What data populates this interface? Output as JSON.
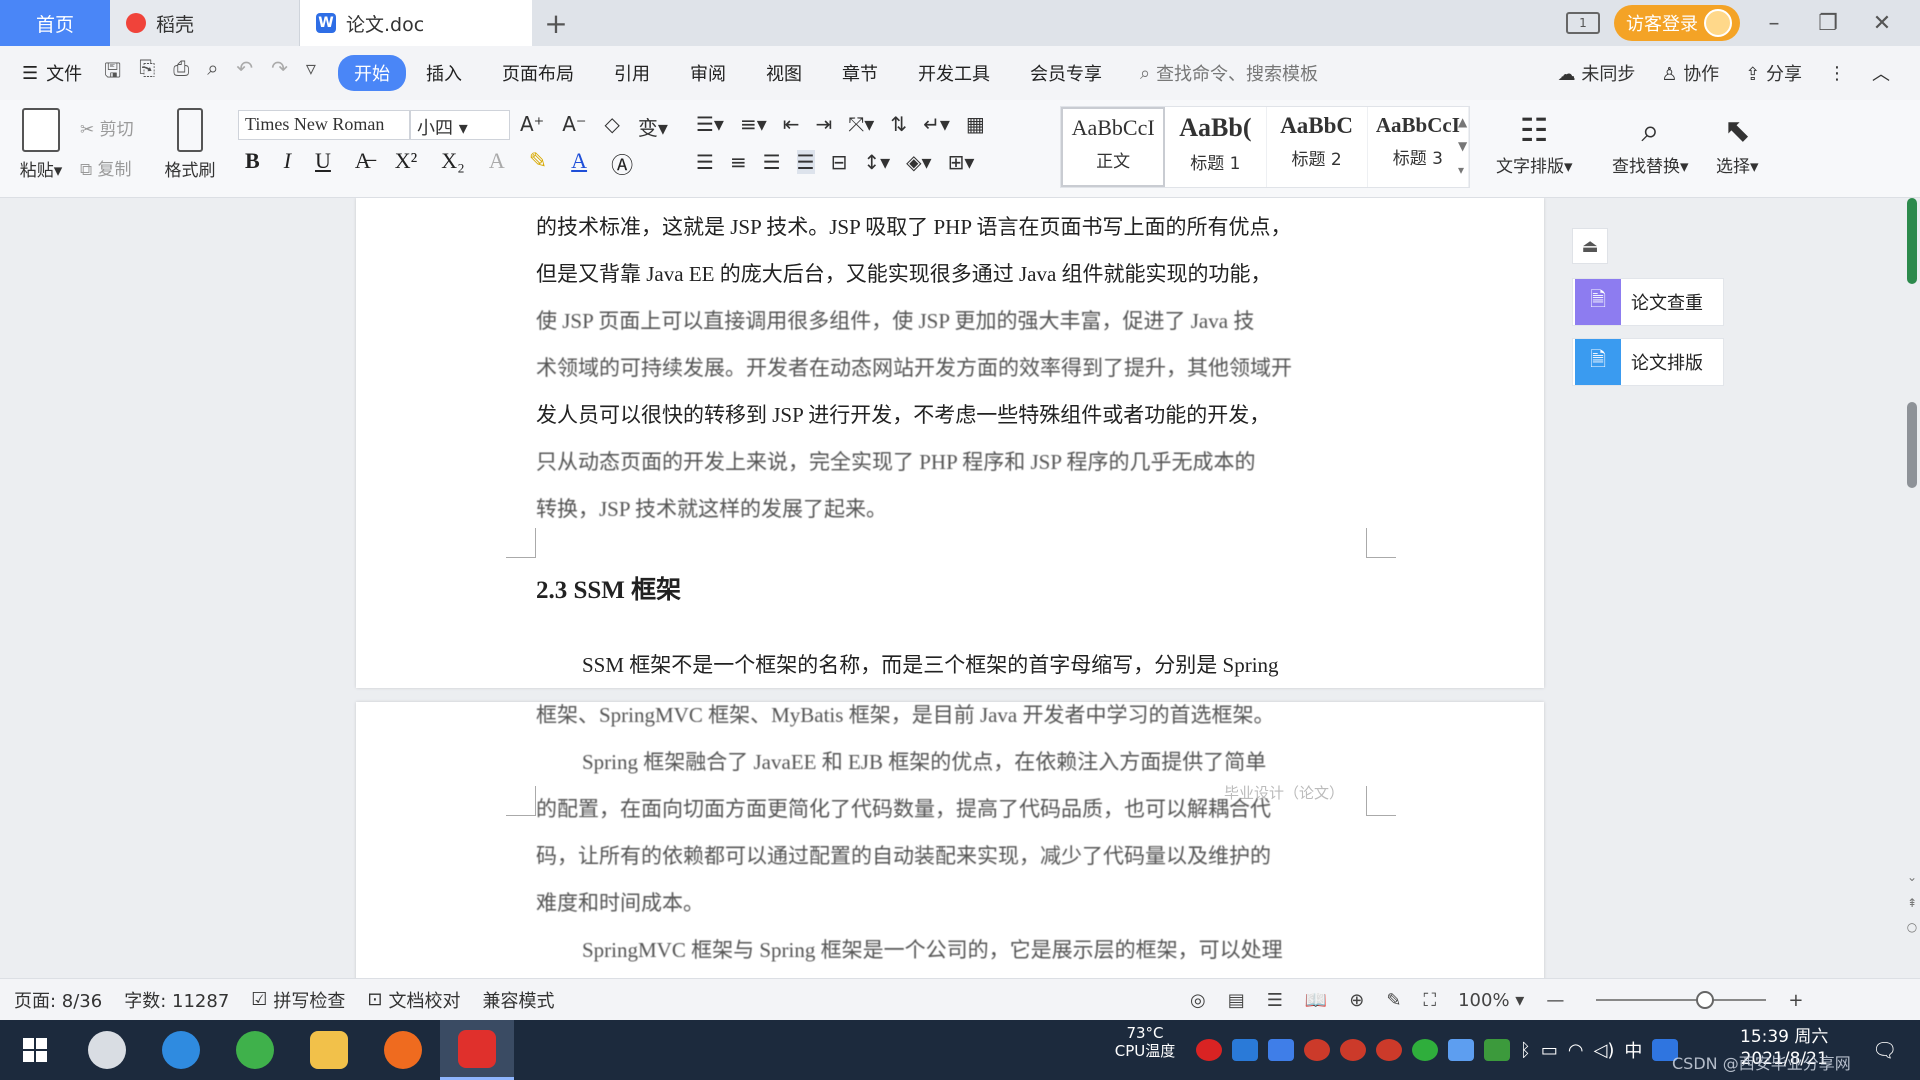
{
  "tabs": {
    "home": "首页",
    "daoke": "稻壳",
    "doc": "论文.doc",
    "visitor_login": "访客登录"
  },
  "menu": {
    "file": "文件",
    "items": [
      "开始",
      "插入",
      "页面布局",
      "引用",
      "审阅",
      "视图",
      "章节",
      "开发工具",
      "会员专享"
    ],
    "search_placeholder": "查找命令、搜索模板",
    "unsynced": "未同步",
    "collaborate": "协作",
    "share": "分享"
  },
  "ribbon": {
    "paste": "粘贴",
    "cut": "剪切",
    "copy": "复制",
    "format_painter": "格式刷",
    "font_name": "Times New Roman",
    "font_size": "小四",
    "styles": [
      {
        "sample": "AaBbCcI",
        "name": "正文"
      },
      {
        "sample": "AaBb(",
        "name": "标题 1"
      },
      {
        "sample": "AaBbC",
        "name": "标题 2"
      },
      {
        "sample": "AaBbCcI",
        "name": "标题 3"
      }
    ],
    "text_layout": "文字排版",
    "find_replace": "查找替换",
    "select": "选择"
  },
  "document": {
    "page1_lines": [
      "的技术标准，这就是 JSP 技术。JSP 吸取了 PHP 语言在页面书写上面的所有优点，",
      "但是又背靠 Java EE 的庞大后台，又能实现很多通过 Java 组件就能实现的功能，",
      "使 JSP 页面上可以直接调用很多组件，使 JSP 更加的强大丰富，促进了 Java 技",
      "术领域的可持续发展。开发者在动态网站开发方面的效率得到了提升，其他领域开",
      "发人员可以很快的转移到 JSP 进行开发，不考虑一些特殊组件或者功能的开发，",
      "只从动态页面的开发上来说，完全实现了 PHP 程序和 JSP 程序的几乎无成本的",
      "转换，JSP 技术就这样的发展了起来。"
    ],
    "heading": "2.3 SSM 框架",
    "page1_tail": "SSM 框架不是一个框架的名称，而是三个框架的首字母缩写，分别是 Spring",
    "page2_lines": [
      "框架、SpringMVC 框架、MyBatis 框架，是目前 Java 开发者中学习的首选框架。",
      "Spring 框架融合了 JavaEE 和 EJB 框架的优点，在依赖注入方面提供了简单",
      "的配置，在面向切面方面更简化了代码数量，提高了代码品质，也可以解耦合代",
      "码，让所有的依赖都可以通过配置的自动装配来实现，减少了代码量以及维护的",
      "难度和时间成本。",
      "SpringMVC 框架与 Spring 框架是一个公司的，它是展示层的框架，可以处理"
    ],
    "watermark": "毕业设计（论文）"
  },
  "side_panel": {
    "check": "论文查重",
    "layout": "论文排版"
  },
  "status": {
    "page": "页面: 8/36",
    "words": "字数: 11287",
    "spell": "拼写检查",
    "proof": "文档校对",
    "compat": "兼容模式",
    "zoom": "100%"
  },
  "taskbar": {
    "cpu_temp": "73°C",
    "cpu_label": "CPU温度",
    "time": "15:39 周六",
    "date": "2021/8/21",
    "csdn": "CSDN @西安毕业分享网"
  },
  "colors": {
    "accent": "#4a86f7",
    "visitor": "#f4a326",
    "taskbar": "#1c2a3d"
  }
}
